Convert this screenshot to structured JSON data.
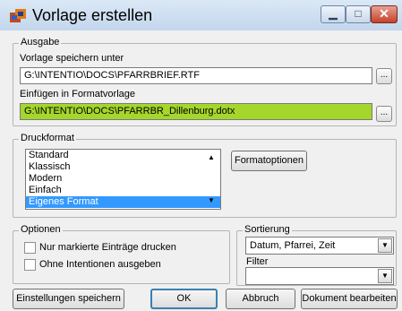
{
  "window": {
    "title": "Vorlage erstellen",
    "close_glyph": "✕",
    "min_glyph": "▁",
    "max_glyph": "□"
  },
  "ausgabe": {
    "group_label": "Ausgabe",
    "save_label": "Vorlage speichern unter",
    "save_path": "G:\\INTENTIO\\DOCS\\PFARRBRIEF.RTF",
    "insert_label": "Einfügen in Formatvorlage",
    "insert_path": "G:\\INTENTIO\\DOCS\\PFARRBR_Dillenburg.dotx",
    "browse_label": "..."
  },
  "druckformat": {
    "group_label": "Druckformat",
    "items": [
      "Standard",
      "Klassisch",
      "Modern",
      "Einfach",
      "Eigenes Format"
    ],
    "selected": "Eigenes Format",
    "format_options_button": "Formatoptionen"
  },
  "optionen": {
    "group_label": "Optionen",
    "checkbox1_label": "Nur markierte Einträge drucken",
    "checkbox1_checked": false,
    "checkbox2_label": "Ohne Intentionen ausgeben",
    "checkbox2_checked": false
  },
  "sortierung": {
    "group_label": "Sortierung",
    "value": "Datum, Pfarrei, Zeit",
    "filter_label": "Filter",
    "filter_value": ""
  },
  "buttons": {
    "save_settings": "Einstellungen speichern",
    "ok": "OK",
    "cancel": "Abbruch",
    "edit_document": "Dokument bearbeiten"
  },
  "colors": {
    "highlight_field": "#a5d62b",
    "selection": "#3399ff",
    "close_button": "#c4412b"
  },
  "icons": [
    "app-icon",
    "minimize-icon",
    "maximize-icon",
    "close-icon",
    "scroll-up-icon",
    "scroll-down-icon",
    "dropdown-arrow-icon"
  ]
}
